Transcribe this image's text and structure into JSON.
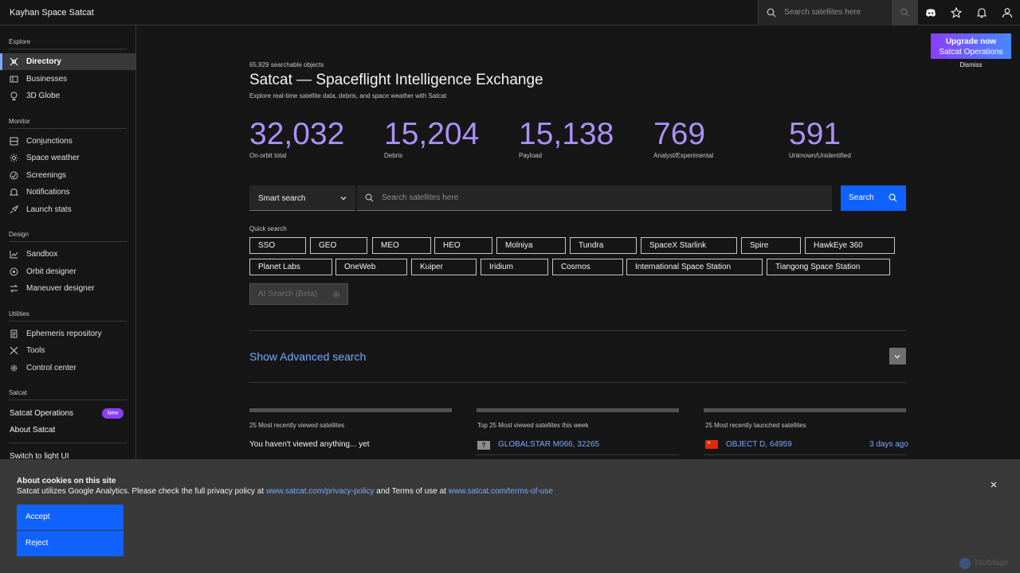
{
  "header": {
    "brand": "Kayhan Space Satcat",
    "search_placeholder": "Search satellites here",
    "icons": [
      "search-icon",
      "discord-icon",
      "star-icon",
      "bell-icon",
      "user-icon"
    ]
  },
  "sidebar": {
    "explore_title": "Explore",
    "monitor_title": "Monitor",
    "design_title": "Design",
    "utilities_title": "Utilities",
    "satcat_title": "Satcat",
    "items": {
      "directory": "Directory",
      "businesses": "Businesses",
      "globe": "3D Globe",
      "conjunctions": "Conjunctions",
      "space_weather": "Space weather",
      "screenings": "Screenings",
      "notifications": "Notifications",
      "launch_stats": "Launch stats",
      "sandbox": "Sandbox",
      "orbit_designer": "Orbit designer",
      "maneuver_designer": "Maneuver designer",
      "ephemeris": "Ephemeris repository",
      "tools": "Tools",
      "control_center": "Control center"
    },
    "satcat_operations": "Satcat Operations",
    "new_badge": "New",
    "about": "About Satcat",
    "switch_theme": "Switch to light UI"
  },
  "upgrade": {
    "line1": "Upgrade now",
    "line2": "Satcat Operations",
    "dismiss": "Dismiss"
  },
  "hero": {
    "count": "65,929 searchable objects",
    "title": "Satcat — Spaceflight Intelligence Exchange",
    "subtitle": "Explore real-time satellite data, debris, and space weather with Satcat"
  },
  "stats": [
    {
      "value": "32,032",
      "label": "On-orbit total"
    },
    {
      "value": "15,204",
      "label": "Debris"
    },
    {
      "value": "15,138",
      "label": "Payload"
    },
    {
      "value": "769",
      "label": "Analyst/Experimental"
    },
    {
      "value": "591",
      "label": "Unknown/Unidentified"
    }
  ],
  "search": {
    "mode": "Smart search",
    "placeholder": "Search satellites here",
    "button": "Search"
  },
  "quick_search": {
    "title": "Quick search",
    "row1": [
      "SSO",
      "GEO",
      "MEO",
      "HEO",
      "Molniya",
      "Tundra",
      "SpaceX Starlink",
      "Spire",
      "HawkEye 360"
    ],
    "row2": [
      "Planet Labs",
      "OneWeb",
      "Kuiper",
      "Iridium",
      "Cosmos",
      "International Space Station",
      "Tiangong Space Station"
    ],
    "ai_search": "AI Search (Beta)"
  },
  "advanced": {
    "label": "Show Advanced search"
  },
  "columns": {
    "recent_viewed": {
      "title": "25 Most recently viewed satellites",
      "empty": "You haven't viewed anything... yet"
    },
    "top_viewed": {
      "title": "Top 25 Most viewed satellites this week",
      "first_item": "GLOBALSTAR M066, 32265"
    },
    "recent_launched": {
      "title": "25 Most recently launched satellites",
      "first_item": "OBJECT D, 64959",
      "first_time": "3 days ago"
    }
  },
  "cookie": {
    "title": "About cookies on this site",
    "text_a": "Satcat utilizes Google Analytics. Please check the full privacy policy at ",
    "privacy_link": "www.satcat.com/privacy-policy",
    "text_b": " and Terms of use at ",
    "terms_link": "www.satcat.com/terms-of-use",
    "accept": "Accept",
    "reject": "Reject"
  },
  "watermark": "ToolMage",
  "colors": {
    "accent": "#0f62fe",
    "stat_number": "#a991f7",
    "link": "#78a9ff",
    "background": "#161616"
  }
}
